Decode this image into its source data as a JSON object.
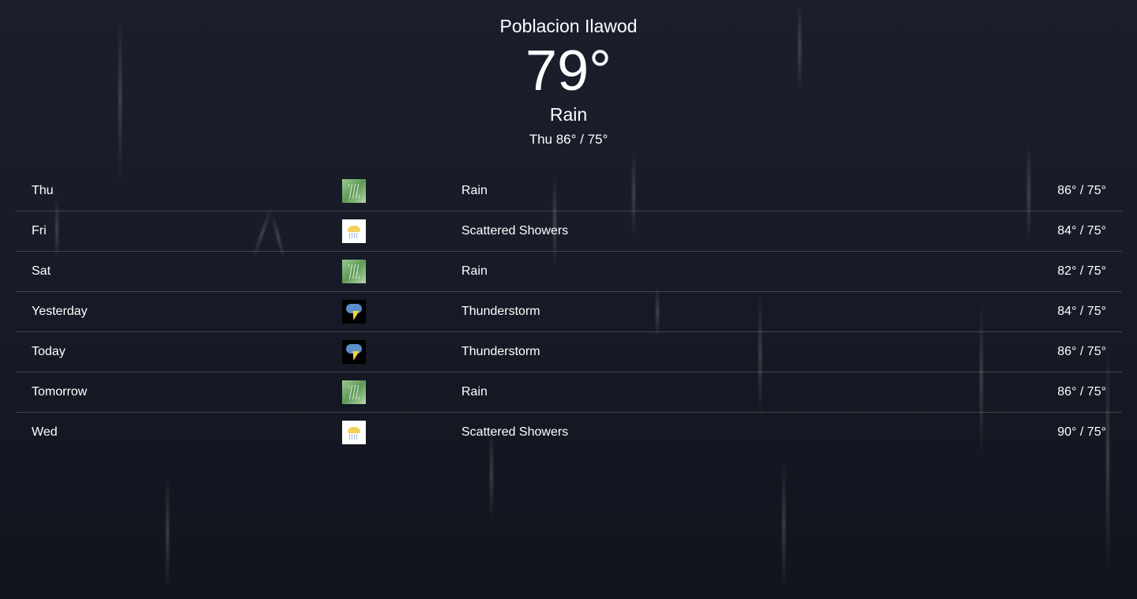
{
  "location": "Poblacion Ilawod",
  "current": {
    "temperature": "79°",
    "condition": "Rain",
    "hilo": "Thu 86° / 75°"
  },
  "forecast": [
    {
      "day": "Thu",
      "icon": "rain-icon",
      "description": "Rain",
      "temps": "86° / 75°"
    },
    {
      "day": "Fri",
      "icon": "scattered-showers-icon",
      "description": "Scattered Showers",
      "temps": "84° / 75°"
    },
    {
      "day": "Sat",
      "icon": "rain-icon",
      "description": "Rain",
      "temps": "82° / 75°"
    },
    {
      "day": "Yesterday",
      "icon": "thunderstorm-icon",
      "description": "Thunderstorm",
      "temps": "84° / 75°"
    },
    {
      "day": "Today",
      "icon": "thunderstorm-icon",
      "description": "Thunderstorm",
      "temps": "86° / 75°"
    },
    {
      "day": "Tomorrow",
      "icon": "rain-icon",
      "description": "Rain",
      "temps": "86° / 75°"
    },
    {
      "day": "Wed",
      "icon": "scattered-showers-icon",
      "description": "Scattered Showers",
      "temps": "90° / 75°"
    }
  ]
}
